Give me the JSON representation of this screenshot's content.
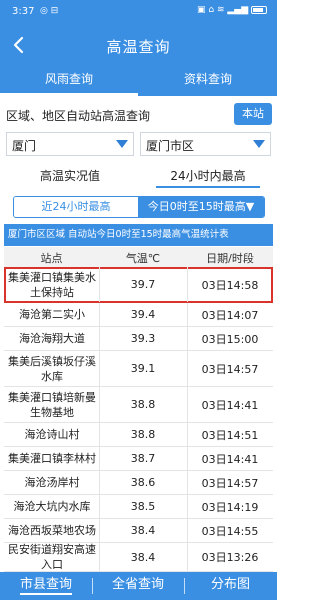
{
  "status_bar": {
    "time": "3:37",
    "left_icons": "◎ ⊟",
    "right_icons": "▣ ⌂ ≋ ▂▄▆"
  },
  "header": {
    "title": "高温查询",
    "back_icon": "back-arrow-icon"
  },
  "tabs": [
    {
      "label": "风雨查询",
      "active": true
    },
    {
      "label": "资料查询",
      "active": false
    }
  ],
  "query": {
    "label": "区域、地区自动站高温查询",
    "station_button": "本站"
  },
  "selects": {
    "city": "厦门",
    "district": "厦门市区"
  },
  "modes": {
    "realtime": "高温实况值",
    "max24": "24小时内最高"
  },
  "range": {
    "option1": "近24小时最高",
    "option2": "今日0时至15时最高▼"
  },
  "banner": "厦门市区区域 自动站今日0时至15时最高气温统计表",
  "table": {
    "headers": [
      "站点",
      "气温℃",
      "日期/时段"
    ],
    "rows": [
      {
        "station": "集美灌口镇集美水土保持站",
        "temp": "39.7",
        "time": "03日14:58",
        "highlight": true
      },
      {
        "station": "海沧第二实小",
        "temp": "39.4",
        "time": "03日14:07"
      },
      {
        "station": "海沧海翔大道",
        "temp": "39.3",
        "time": "03日15:00"
      },
      {
        "station": "集美后溪镇坂仔溪水库",
        "temp": "39.1",
        "time": "03日14:57"
      },
      {
        "station": "集美灌口镇培新曼生物基地",
        "temp": "38.8",
        "time": "03日14:41"
      },
      {
        "station": "海沧诗山村",
        "temp": "38.8",
        "time": "03日14:51"
      },
      {
        "station": "集美灌口镇李林村",
        "temp": "38.7",
        "time": "03日14:41"
      },
      {
        "station": "海沧汤岸村",
        "temp": "38.6",
        "time": "03日14:57"
      },
      {
        "station": "海沧大坑内水库",
        "temp": "38.5",
        "time": "03日14:19"
      },
      {
        "station": "海沧西坂菜地农场",
        "temp": "38.4",
        "time": "03日14:55"
      },
      {
        "station": "民安街道翔安高速入口",
        "temp": "38.4",
        "time": "03日13:26"
      }
    ]
  },
  "bottom_nav": [
    {
      "label": "市县查询",
      "active": true
    },
    {
      "label": "全省查询",
      "active": false
    },
    {
      "label": "分布图",
      "active": false
    }
  ],
  "colors": {
    "primary": "#3a8fe3",
    "highlight_border": "#d9342b"
  }
}
